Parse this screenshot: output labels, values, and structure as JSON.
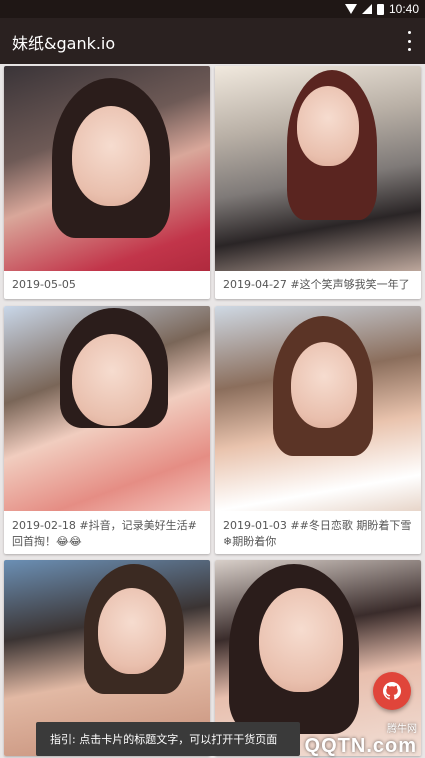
{
  "status_bar": {
    "time": "10:40",
    "icons": [
      "wifi-icon",
      "signal-icon",
      "battery-icon"
    ]
  },
  "app": {
    "title": "妹纸&gank.io",
    "menu_icon": "more-vert-icon"
  },
  "cards": [
    {
      "caption": "2019-05-05"
    },
    {
      "caption": "2019-04-27 #这个笑声够我笑一年了"
    },
    {
      "caption": "2019-02-18 #抖音，记录美好生活# 回首掏！😂😂"
    },
    {
      "caption": "2019-01-03 ##冬日恋歌 期盼着下雪❄期盼着你"
    },
    {
      "caption": ""
    },
    {
      "caption": ""
    }
  ],
  "fab": {
    "icon": "github-icon"
  },
  "toast": {
    "text": "指引: 点击卡片的标题文字，可以打开干货页面"
  },
  "watermark": {
    "small": "腾牛网",
    "big": "QQTN.com"
  },
  "colors": {
    "toolbar": "#2a2120",
    "status_bar": "#1f1715",
    "fab": "#e0453a",
    "background": "#e9e6e6"
  }
}
